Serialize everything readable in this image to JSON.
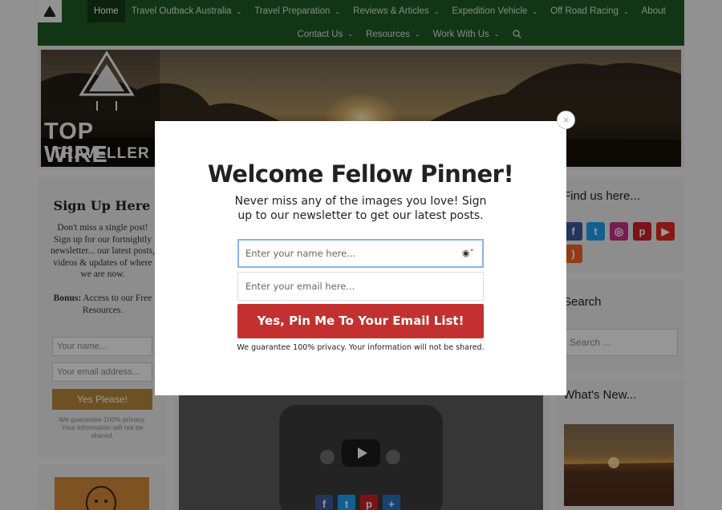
{
  "nav": {
    "row1": [
      {
        "label": "Home",
        "chevron": false,
        "active": true
      },
      {
        "label": "Travel Outback Australia",
        "chevron": true
      },
      {
        "label": "Travel Preparation",
        "chevron": true
      },
      {
        "label": "Reviews & Articles",
        "chevron": true
      },
      {
        "label": "Expedition Vehicle",
        "chevron": true
      },
      {
        "label": "Off Road Racing",
        "chevron": true
      },
      {
        "label": "About",
        "chevron": false
      }
    ],
    "row2": [
      {
        "label": "Contact Us",
        "chevron": true
      },
      {
        "label": "Resources",
        "chevron": true
      },
      {
        "label": "Work With Us",
        "chevron": true
      }
    ]
  },
  "header": {
    "logo_line1": "TOP WIRE",
    "logo_line2": "TRAVELLER"
  },
  "left_sidebar": {
    "title": "Sign Up Here",
    "text": "Don't miss a single post! Sign up for our fortnightly newsletter... our latest posts, videos & updates of where we are now.",
    "bonus_label": "Bonus:",
    "bonus_text": " Access to our Free Resources.",
    "name_placeholder": "Your name...",
    "email_placeholder": "Your email address...",
    "button_label": "Yes Please!",
    "fine_print": "We guarantee 100% privacy. Your information will not be shared."
  },
  "right_sidebar": {
    "find_title": "Find us here...",
    "search_title": "Search",
    "search_placeholder": "Search ...",
    "whats_new_title": "What's New..."
  },
  "social_icons": [
    "facebook-icon",
    "twitter-icon",
    "instagram-icon",
    "pinterest-icon",
    "youtube-icon",
    "rss-icon"
  ],
  "share_icons": [
    "facebook-icon",
    "twitter-icon",
    "pinterest-icon",
    "add-share-icon"
  ],
  "colors": {
    "nav_bg": "#1e5a23",
    "modal_button": "#c2312f",
    "focus_border": "#8ab2ea",
    "sidebar_button": "#b8873a"
  },
  "modal": {
    "title": "Welcome Fellow Pinner!",
    "subtitle": "Never miss any of the images you love! Sign up to our newsletter to get our latest posts.",
    "name_placeholder": "Enter your name here...",
    "email_placeholder": "Enter your email here...",
    "button_label": "Yes, Pin Me To Your Email List!",
    "fine_print": "We guarantee 100% privacy. Your information will not be shared.",
    "close_symbol": "×"
  }
}
